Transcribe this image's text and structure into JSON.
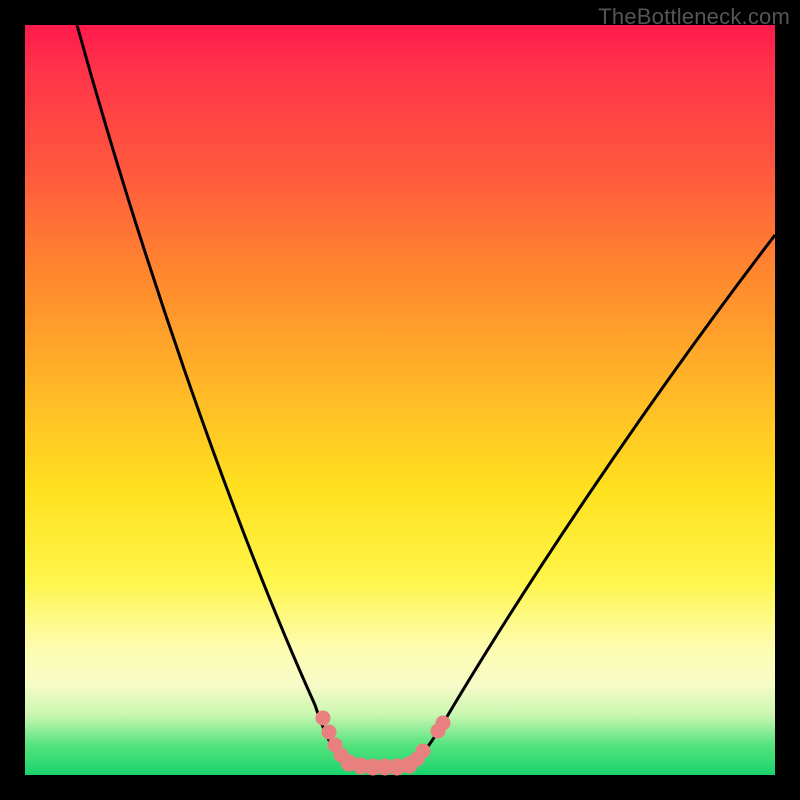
{
  "watermark": "TheBottleneck.com",
  "colors": {
    "background": "#000000",
    "curve": "#000000",
    "dots": "#e57373",
    "gradient_top": "#ff1a4d",
    "gradient_bottom": "#19d36a"
  },
  "chart_data": {
    "type": "line",
    "title": "",
    "xlabel": "",
    "ylabel": "",
    "xlim": [
      0,
      100
    ],
    "ylim": [
      0,
      100
    ],
    "grid": false,
    "legend": false,
    "series": [
      {
        "name": "bottleneck-curve",
        "x": [
          7,
          10,
          15,
          20,
          25,
          30,
          35,
          38,
          40,
          42,
          44,
          46,
          48,
          50,
          52,
          55,
          60,
          65,
          70,
          75,
          80,
          85,
          90,
          95,
          100
        ],
        "y": [
          100,
          90,
          75,
          60,
          46,
          33,
          21,
          13,
          8,
          4,
          2,
          1,
          1,
          1,
          2,
          5,
          12,
          20,
          29,
          38,
          46,
          54,
          61,
          67,
          72
        ]
      }
    ],
    "highlight_points": {
      "name": "bottom-dots",
      "x": [
        40,
        41,
        42,
        43,
        44,
        45,
        46,
        47,
        48,
        49,
        50,
        51,
        52,
        53
      ],
      "y": [
        8,
        5,
        4,
        3,
        2,
        1,
        1,
        1,
        1,
        1,
        1,
        2,
        3,
        5
      ]
    },
    "notes": "Axes are unlabeled in the source image; x and y are normalized 0–100. Curve is a V-shaped valley with a flat bottom near x≈44–50 at y≈1. Salmon-colored dots trace the bottom of the valley."
  }
}
